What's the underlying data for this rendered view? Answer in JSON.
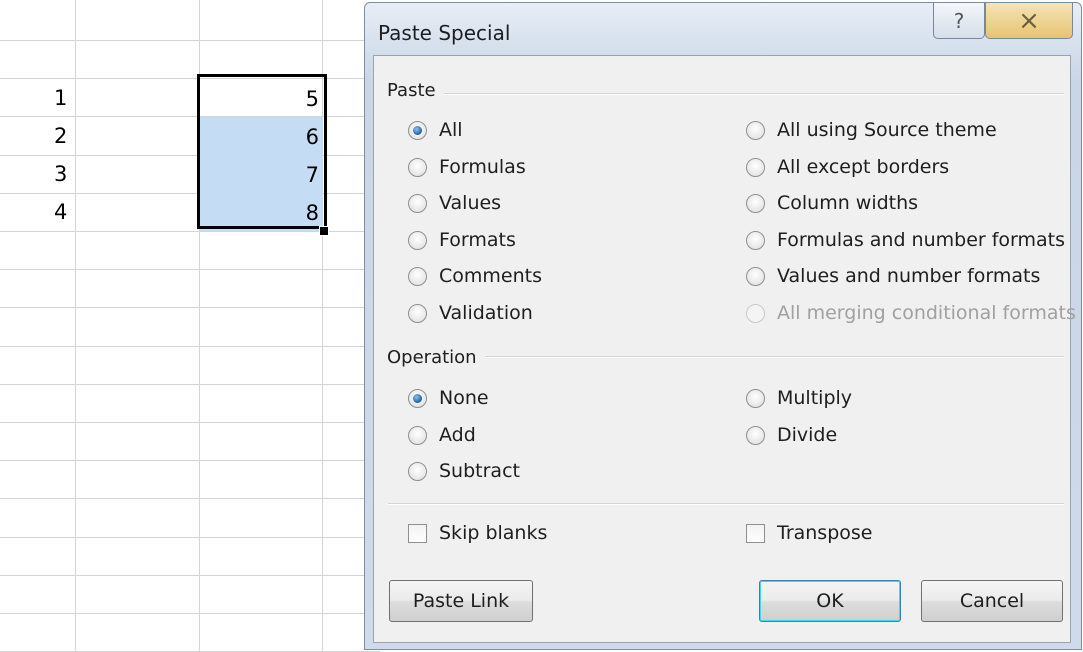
{
  "sheet": {
    "rows": [
      {
        "row": "1",
        "value": "5",
        "highlighted": false
      },
      {
        "row": "2",
        "value": "6",
        "highlighted": true
      },
      {
        "row": "3",
        "value": "7",
        "highlighted": true
      },
      {
        "row": "4",
        "value": "8",
        "highlighted": true
      }
    ]
  },
  "dialog": {
    "title": "Paste Special",
    "help_icon": "?",
    "close_icon": "×",
    "paste_group": {
      "label": "Paste",
      "options_left": [
        {
          "label": "All",
          "checked": true
        },
        {
          "label": "Formulas",
          "checked": false
        },
        {
          "label": "Values",
          "checked": false
        },
        {
          "label": "Formats",
          "checked": false
        },
        {
          "label": "Comments",
          "checked": false
        },
        {
          "label": "Validation",
          "checked": false
        }
      ],
      "options_right": [
        {
          "label": "All using Source theme",
          "checked": false,
          "disabled": false
        },
        {
          "label": "All except borders",
          "checked": false,
          "disabled": false
        },
        {
          "label": "Column widths",
          "checked": false,
          "disabled": false
        },
        {
          "label": "Formulas and number formats",
          "checked": false,
          "disabled": false
        },
        {
          "label": "Values and number formats",
          "checked": false,
          "disabled": false
        },
        {
          "label": "All merging conditional formats",
          "checked": false,
          "disabled": true
        }
      ]
    },
    "operation_group": {
      "label": "Operation",
      "options_left": [
        {
          "label": "None",
          "checked": true
        },
        {
          "label": "Add",
          "checked": false
        },
        {
          "label": "Subtract",
          "checked": false
        }
      ],
      "options_right": [
        {
          "label": "Multiply",
          "checked": false
        },
        {
          "label": "Divide",
          "checked": false
        }
      ]
    },
    "skip_blanks": {
      "label": "Skip blanks",
      "checked": false
    },
    "transpose": {
      "label": "Transpose",
      "checked": false
    },
    "buttons": {
      "paste_link": "Paste Link",
      "ok": "OK",
      "cancel": "Cancel"
    }
  }
}
